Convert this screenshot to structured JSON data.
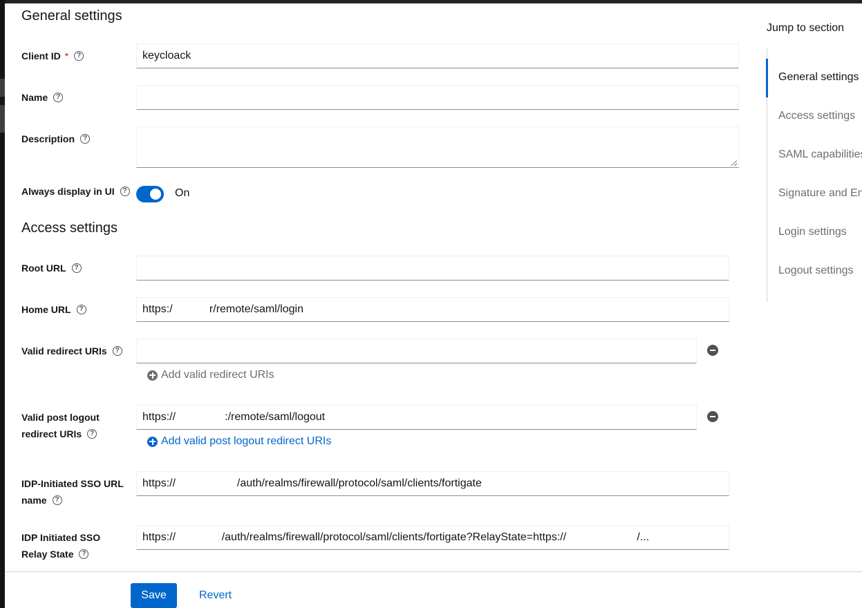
{
  "general": {
    "title": "General settings",
    "client_id": {
      "label": "Client ID",
      "required": "*",
      "value": "keycloack"
    },
    "name": {
      "label": "Name",
      "value": ""
    },
    "description": {
      "label": "Description",
      "value": ""
    },
    "always_display": {
      "label": "Always display in UI",
      "state": "On",
      "enabled": true
    }
  },
  "access": {
    "title": "Access settings",
    "root_url": {
      "label": "Root URL",
      "value": ""
    },
    "home_url": {
      "label": "Home URL",
      "value": "https:/            r/remote/saml/login"
    },
    "valid_redirect": {
      "label": "Valid redirect URIs",
      "value": "",
      "add_label": "Add valid redirect URIs"
    },
    "post_logout": {
      "label_line1": "Valid post logout",
      "label_line2": "redirect URIs",
      "value": "https://                :/remote/saml/logout",
      "add_label": "Add valid post logout redirect URIs"
    },
    "idp_sso_name": {
      "label_line1": "IDP-Initiated SSO URL",
      "label_line2": "name",
      "value": "https://                    /auth/realms/firewall/protocol/saml/clients/fortigate"
    },
    "idp_relay": {
      "label_line1": "IDP Initiated SSO",
      "label_line2": "Relay State",
      "value": "https://               /auth/realms/firewall/protocol/saml/clients/fortigate?RelayState=https://                       /..."
    }
  },
  "footer": {
    "save": "Save",
    "revert": "Revert"
  },
  "jump": {
    "title": "Jump to section",
    "items": [
      "General settings",
      "Access settings",
      "SAML capabilities",
      "Signature and Encryption",
      "Login settings",
      "Logout settings"
    ]
  },
  "icons": {
    "help": "help-icon",
    "remove": "minus-circle-icon",
    "add": "plus-circle-icon"
  },
  "colors": {
    "primary": "#0066cc",
    "required": "#c9190b",
    "muted": "#6a6e73"
  }
}
